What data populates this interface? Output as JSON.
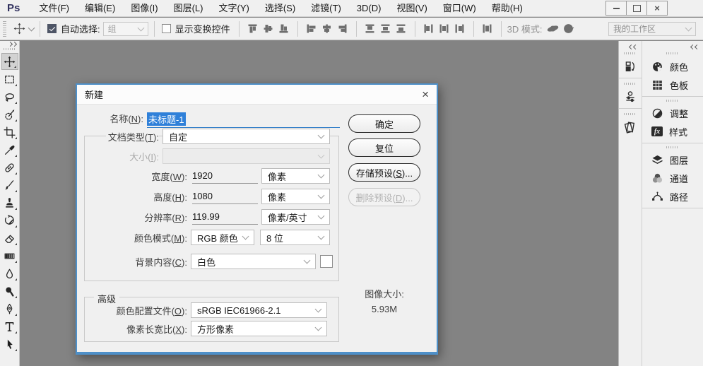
{
  "window": {
    "logo": "Ps",
    "controls": {
      "minimize": "minimize",
      "maximize": "maximize",
      "close": "×"
    }
  },
  "menu": {
    "items": [
      "文件(F)",
      "编辑(E)",
      "图像(I)",
      "图层(L)",
      "文字(Y)",
      "选择(S)",
      "滤镜(T)",
      "3D(D)",
      "视图(V)",
      "窗口(W)",
      "帮助(H)"
    ]
  },
  "options_bar": {
    "auto_select": {
      "label": "自动选择:",
      "checked": true,
      "value": "组"
    },
    "show_transform": {
      "label": "显示变换控件",
      "checked": false
    },
    "mode_3d_label": "3D 模式:",
    "workspace": "我的工作区"
  },
  "toolbar": {
    "selected_tool": "move",
    "tools": [
      "move",
      "rectangular-marquee",
      "lasso",
      "quick-selection",
      "crop",
      "eyedropper",
      "spot-healing-brush",
      "brush",
      "clone-stamp",
      "history-brush",
      "eraser",
      "gradient",
      "blur",
      "dodge",
      "pen",
      "type",
      "path-selection"
    ]
  },
  "dialog": {
    "title": "新建",
    "rows": {
      "name": {
        "pre": "名称(",
        "key": "N",
        "post": "):",
        "value": "未标题-1"
      },
      "doc_type": {
        "pre": "文档类型(",
        "key": "T",
        "post": "):",
        "value": "自定"
      },
      "size": {
        "pre": "大小(",
        "key": "I",
        "post": "):",
        "value": ""
      },
      "width": {
        "pre": "宽度(",
        "key": "W",
        "post": "):",
        "value": "1920",
        "unit": "像素"
      },
      "height": {
        "pre": "高度(",
        "key": "H",
        "post": "):",
        "value": "1080",
        "unit": "像素"
      },
      "resolution": {
        "pre": "分辨率(",
        "key": "R",
        "post": "):",
        "value": "119.99",
        "unit": "像素/英寸"
      },
      "color_mode": {
        "pre": "颜色模式(",
        "key": "M",
        "post": "):",
        "value": "RGB 颜色",
        "depth": "8 位"
      },
      "background": {
        "pre": "背景内容(",
        "key": "C",
        "post": "):",
        "value": "白色"
      },
      "advanced": "高级",
      "profile": {
        "pre": "颜色配置文件(",
        "key": "O",
        "post": "):",
        "value": "sRGB IEC61966-2.1"
      },
      "aspect": {
        "pre": "像素长宽比(",
        "key": "X",
        "post": "):",
        "value": "方形像素"
      }
    },
    "buttons": {
      "ok": "确定",
      "reset": "复位",
      "save_preset": {
        "pre": "存储预设(",
        "key": "S",
        "post": ")..."
      },
      "delete_preset": {
        "pre": "删除预设(",
        "key": "D",
        "post": ")..."
      }
    },
    "image_size": {
      "label": "图像大小:",
      "value": "5.93M"
    }
  },
  "right_dock": {
    "narrow_icons": [
      "history",
      "properties",
      "libraries"
    ],
    "panels": [
      {
        "label": "颜色"
      },
      {
        "label": "色板"
      },
      {
        "label": "调整"
      },
      {
        "label": "样式"
      },
      {
        "label": "图层"
      },
      {
        "label": "通道"
      },
      {
        "label": "路径"
      }
    ]
  },
  "colors": {
    "accent_blue": "#2f80d9",
    "dialog_border": "#4e90c9",
    "canvas_gray": "#838383",
    "chrome_gray": "#f0f0f0"
  }
}
